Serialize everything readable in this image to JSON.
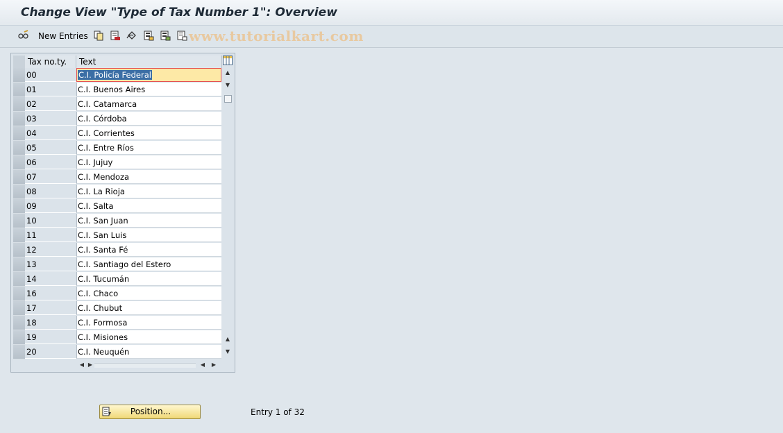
{
  "window": {
    "title": "Change View \"Type of Tax Number 1\": Overview"
  },
  "toolbar": {
    "new_entries_label": "New Entries",
    "icons": [
      "glasses-pencil-icon",
      "copy-icon",
      "delete-icon",
      "undo-icon",
      "select-all-icon",
      "select-block-icon",
      "deselect-all-icon"
    ]
  },
  "watermark": "www.tutorialkart.com",
  "table": {
    "columns": {
      "key": "Tax no.ty.",
      "text": "Text"
    },
    "rows": [
      {
        "key": "00",
        "text": "C.I. Policía Federal"
      },
      {
        "key": "01",
        "text": "C.I. Buenos Aires"
      },
      {
        "key": "02",
        "text": "C.I. Catamarca"
      },
      {
        "key": "03",
        "text": "C.I. Córdoba"
      },
      {
        "key": "04",
        "text": "C.I. Corrientes"
      },
      {
        "key": "05",
        "text": "C.I. Entre Ríos"
      },
      {
        "key": "06",
        "text": "C.I. Jujuy"
      },
      {
        "key": "07",
        "text": "C.I. Mendoza"
      },
      {
        "key": "08",
        "text": "C.I. La Rioja"
      },
      {
        "key": "09",
        "text": "C.I. Salta"
      },
      {
        "key": "10",
        "text": "C.I. San Juan"
      },
      {
        "key": "11",
        "text": "C.I. San Luis"
      },
      {
        "key": "12",
        "text": "C.I. Santa Fé"
      },
      {
        "key": "13",
        "text": "C.I. Santiago del Estero"
      },
      {
        "key": "14",
        "text": "C.I. Tucumán"
      },
      {
        "key": "16",
        "text": "C.I. Chaco"
      },
      {
        "key": "17",
        "text": "C.I. Chubut"
      },
      {
        "key": "18",
        "text": "C.I. Formosa"
      },
      {
        "key": "19",
        "text": "C.I. Misiones"
      },
      {
        "key": "20",
        "text": "C.I. Neuquén"
      }
    ]
  },
  "footer": {
    "position_button_label": "Position...",
    "entry_info": "Entry 1 of 32"
  }
}
